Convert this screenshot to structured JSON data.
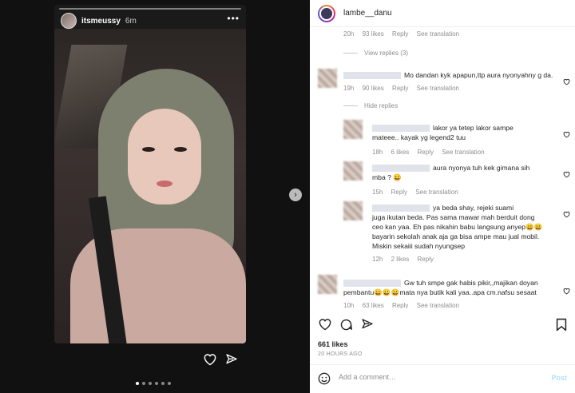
{
  "story": {
    "username": "itsmeussy",
    "time": "6m",
    "more": "•••",
    "dots_count": 6,
    "active_dot": 1
  },
  "post": {
    "username": "lambe__danu",
    "likes": "661 likes",
    "ago": "20 HOURS AGO",
    "add_comment_placeholder": "Add a comment…",
    "post_label": "Post"
  },
  "comments": {
    "c0": {
      "time": "20h",
      "likes": "93 likes",
      "reply": "Reply",
      "translate": "See translation"
    },
    "view_replies": "View replies (3)",
    "c1": {
      "text": "Mo dandan kyk apapun,ttp aura nyonyahny g da.",
      "time": "19h",
      "likes": "90 likes",
      "reply": "Reply",
      "translate": "See translation"
    },
    "hide_replies": "Hide replies",
    "r1": {
      "text1": "lakor ya tetep lakor sampe",
      "text2": "mateee.. kayak yg legend2 tuu",
      "time": "18h",
      "likes": "6 likes",
      "reply": "Reply",
      "translate": "See translation"
    },
    "r2": {
      "text1": "aura nyonya tuh kek gimana sih",
      "text2": "mba ? 😀",
      "time": "15h",
      "reply": "Reply",
      "translate": "See translation"
    },
    "r3": {
      "text1": "ya beda shay, rejeki suami",
      "text2": "juga ikutan beda. Pas sama mawar mah berduit dong",
      "text3": "ceo kan yaa. Eh pas nikahin babu langsung anyep😀😀",
      "text4": "bayarin sekolah anak aja ga bisa ampe mau jual mobil.",
      "text5": "Miskin sekaiii sudah nyungsep",
      "time": "12h",
      "likes": "2 likes",
      "reply": "Reply"
    },
    "c2": {
      "text1": "Gw tuh smpe gak habis pikir,,majikan doyan",
      "text2": "pembantu😀😀😀mata nya butik kali yaa..apa cm.nafsu sesaat",
      "time": "10h",
      "likes": "63 likes",
      "reply": "Reply",
      "translate": "See translation"
    }
  },
  "colors": {
    "panel_bg": "#ffffff",
    "media_bg": "#111111",
    "muted_text": "#8e8e8e",
    "post_link": "#b2dffc"
  },
  "icons": [
    "heart-icon",
    "send-icon",
    "comment-icon",
    "bookmark-icon",
    "emoji-icon",
    "chevron-right-icon"
  ]
}
